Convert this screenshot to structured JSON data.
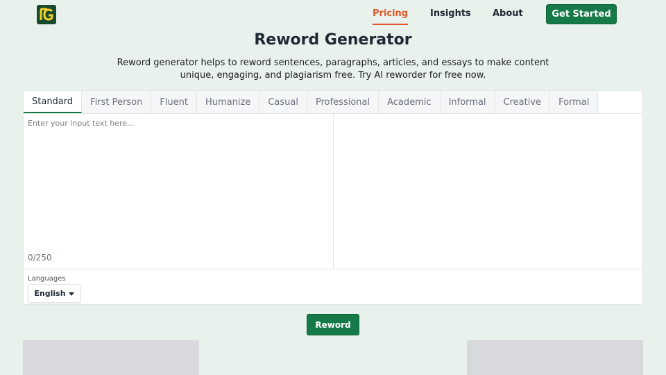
{
  "brand": {
    "logo_icon": "rg-logo-icon",
    "colors": {
      "accent": "#157a47",
      "active_nav": "#e0582a",
      "logo_bg": "#184a2c"
    }
  },
  "nav": {
    "pricing": "Pricing",
    "insights": "Insights",
    "about": "About",
    "cta": "Get Started"
  },
  "hero": {
    "title": "Reword Generator",
    "subtitle": "Reword generator helps to reword sentences, paragraphs, articles, and essays to make content unique, engaging, and plagiarism free. Try AI reworder for free now."
  },
  "tabs": [
    "Standard",
    "First Person",
    "Fluent",
    "Humanize",
    "Casual",
    "Professional",
    "Academic",
    "Informal",
    "Creative",
    "Formal"
  ],
  "editor": {
    "placeholder": "Enter your input text here...",
    "counter": "0/250"
  },
  "language": {
    "label": "Languages",
    "selected": "English"
  },
  "action": {
    "reword": "Reword"
  }
}
